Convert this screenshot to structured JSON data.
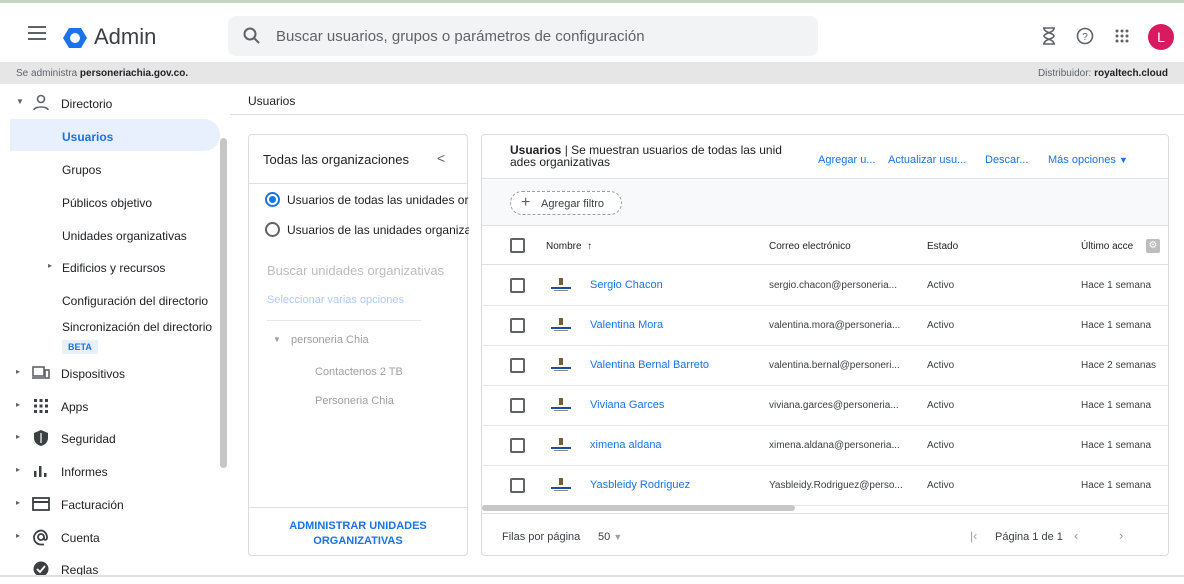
{
  "app": {
    "title": "Admin"
  },
  "search": {
    "placeholder": "Buscar usuarios, grupos o parámetros de configuración"
  },
  "user": {
    "avatar_letter": "L",
    "avatar_color": "#d81b60"
  },
  "infobar": {
    "managed_prefix": "Se administra ",
    "managed_domain": "personeriachia.gov.co.",
    "distributor_prefix": "Distribuidor: ",
    "distributor": "royaltech.cloud"
  },
  "sidebar": {
    "directory": "Directorio",
    "items": [
      {
        "label": "Usuarios",
        "active": true
      },
      {
        "label": "Grupos"
      },
      {
        "label": "Públicos objetivo"
      },
      {
        "label": "Unidades organizativas"
      },
      {
        "label": "Edificios y recursos"
      },
      {
        "label": "Configuración del directorio"
      },
      {
        "label": "Sincronización del directorio",
        "badge": "BETA"
      }
    ],
    "sections": [
      {
        "label": "Dispositivos",
        "icon": "devices-icon"
      },
      {
        "label": "Apps",
        "icon": "apps-grid-icon"
      },
      {
        "label": "Seguridad",
        "icon": "shield-icon"
      },
      {
        "label": "Informes",
        "icon": "bar-chart-icon"
      },
      {
        "label": "Facturación",
        "icon": "credit-card-icon"
      },
      {
        "label": "Cuenta",
        "icon": "at-sign-icon"
      },
      {
        "label": "Reglas",
        "icon": "rules-icon"
      }
    ]
  },
  "breadcrumb": "Usuarios",
  "org_panel": {
    "title": "Todas las organizaciones",
    "collapse": "<",
    "radio_all": "Usuarios de todas las unidades org",
    "radio_selected": "Usuarios de las unidades organiza",
    "search_placeholder": "Buscar unidades organizativas",
    "multi_select": "Seleccionar varias opciones",
    "tree_root": "personeria Chia",
    "tree_children": [
      "Contactenos 2 TB",
      "Personeria Chia"
    ],
    "admin_button": "ADMINISTRAR UNIDADES ORGANIZATIVAS"
  },
  "users_panel": {
    "title_bold": "Usuarios",
    "title_rest": " | Se muestran usuarios de todas las unid ades organizativas",
    "actions": [
      "Agregar u...",
      "Actualizar usu...",
      "Descar...",
      "Más opciones"
    ],
    "add_filter": "Agregar filtro",
    "columns": {
      "name": "Nombre",
      "sort": "↑",
      "email": "Correo electrónico",
      "status": "Estado",
      "last": "Último acce"
    },
    "rows": [
      {
        "name": "Sergio Chacon",
        "email": "sergio.chacon@personeria...",
        "status": "Activo",
        "last": "Hace 1 semana"
      },
      {
        "name": "Valentina Mora",
        "email": "valentina.mora@personeria...",
        "status": "Activo",
        "last": "Hace 1 semana"
      },
      {
        "name": "Valentina Bernal Barreto",
        "email": "valentina.bernal@personeri...",
        "status": "Activo",
        "last": "Hace 2 semanas"
      },
      {
        "name": "Viviana Garces",
        "email": "viviana.garces@personeria...",
        "status": "Activo",
        "last": "Hace 1 semana"
      },
      {
        "name": "ximena aldana",
        "email": "ximena.aldana@personeria...",
        "status": "Activo",
        "last": "Hace 1 semana"
      },
      {
        "name": "Yasbleidy Rodriguez",
        "email": "Yasbleidy.Rodriguez@perso...",
        "status": "Activo",
        "last": "Hace 1 semana"
      }
    ],
    "rows_per_page_label": "Filas por página",
    "rows_per_page": "50",
    "page_label": "Página 1 de 1"
  },
  "colors": {
    "accent": "#1a73e8",
    "active_bg": "#e8f0fe"
  }
}
